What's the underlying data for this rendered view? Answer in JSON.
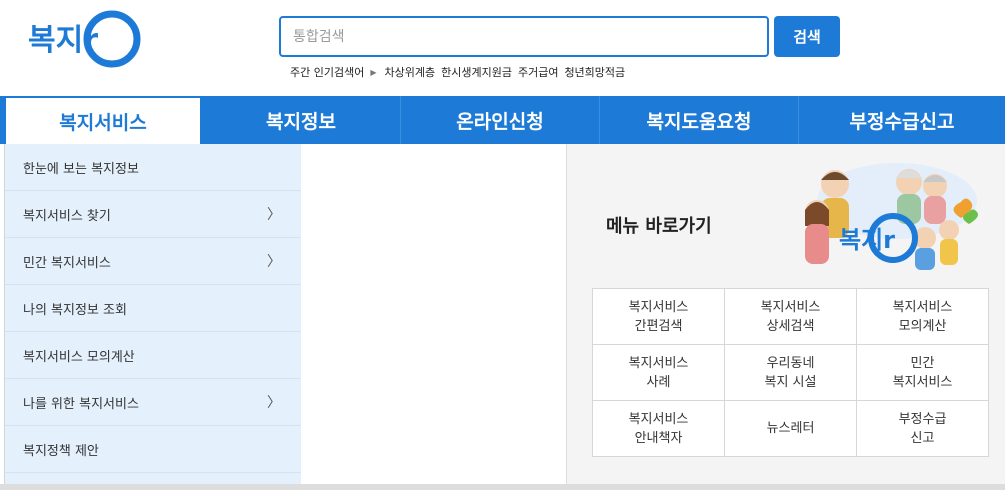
{
  "header": {
    "logo_text": "복지r",
    "search_placeholder": "통합검색",
    "search_button": "검색",
    "popular_label": "주간 인기검색어",
    "popular_keywords": [
      "차상위계층",
      "한시생계지원금",
      "주거급여",
      "청년희망적금"
    ]
  },
  "gnb": {
    "items": [
      "복지서비스",
      "복지정보",
      "온라인신청",
      "복지도움요청",
      "부정수급신고"
    ]
  },
  "side_menu": {
    "items": [
      {
        "label": "한눈에 보는 복지정보",
        "has_sub": false
      },
      {
        "label": "복지서비스 찾기",
        "has_sub": true
      },
      {
        "label": "민간 복지서비스",
        "has_sub": true
      },
      {
        "label": "나의 복지정보 조회",
        "has_sub": false
      },
      {
        "label": "복지서비스 모의계산",
        "has_sub": false
      },
      {
        "label": "나를 위한 복지서비스",
        "has_sub": true
      },
      {
        "label": "복지정책 제안",
        "has_sub": false
      }
    ]
  },
  "shortcut": {
    "title": "메뉴 바로가기",
    "mascot_text": "복지r",
    "rows": [
      [
        [
          "복지서비스",
          "간편검색"
        ],
        [
          "복지서비스",
          "상세검색"
        ],
        [
          "복지서비스",
          "모의계산"
        ]
      ],
      [
        [
          "복지서비스",
          "사례"
        ],
        [
          "우리동네",
          "복지 시설"
        ],
        [
          "민간",
          "복지서비스"
        ]
      ],
      [
        [
          "복지서비스",
          "안내책자"
        ],
        [
          "뉴스레터"
        ],
        [
          "부정수급",
          "신고"
        ]
      ]
    ]
  },
  "icons": {
    "popular_arrow": "triangle-right-icon",
    "sub_chevron": "chevron-right-icon"
  },
  "colors": {
    "primary": "#1d7ad6",
    "side_bg": "#e4f0fc",
    "panel_bg": "#f4f4f4"
  }
}
